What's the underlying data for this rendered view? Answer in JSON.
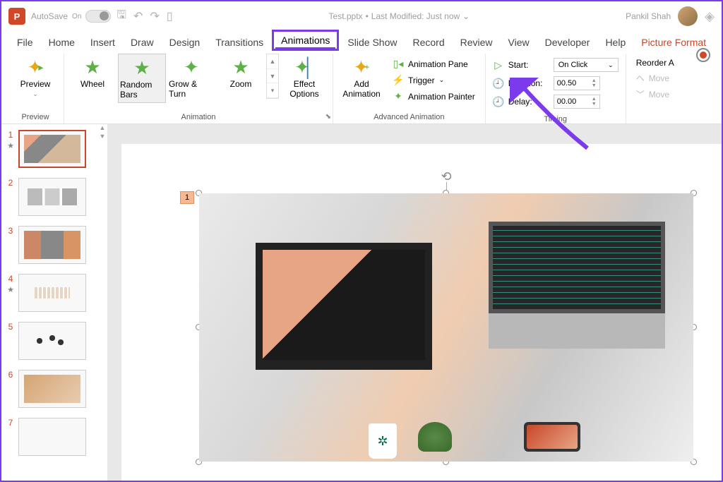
{
  "titlebar": {
    "app_letter": "P",
    "autosave_label": "AutoSave",
    "autosave_state": "On",
    "filename": "Test.pptx",
    "modified": "Last Modified: Just now",
    "username": "Pankil Shah"
  },
  "tabs": [
    "File",
    "Home",
    "Insert",
    "Draw",
    "Design",
    "Transitions",
    "Animations",
    "Slide Show",
    "Record",
    "Review",
    "View",
    "Developer",
    "Help",
    "Picture Format"
  ],
  "active_tab": "Animations",
  "ribbon": {
    "preview": {
      "label": "Preview",
      "group": "Preview"
    },
    "animations": {
      "items": [
        "Wheel",
        "Random Bars",
        "Grow & Turn",
        "Zoom"
      ],
      "selected": "Random Bars",
      "group_label": "Animation"
    },
    "effect_options": "Effect\nOptions",
    "advanced": {
      "add_animation": "Add\nAnimation",
      "animation_pane": "Animation Pane",
      "trigger": "Trigger",
      "animation_painter": "Animation Painter",
      "group_label": "Advanced Animation"
    },
    "timing": {
      "start_label": "Start:",
      "start_value": "On Click",
      "duration_label": "Duration:",
      "duration_value": "00.50",
      "delay_label": "Delay:",
      "delay_value": "00.00",
      "group_label": "Timing"
    },
    "reorder": {
      "title": "Reorder A",
      "move_earlier": "Move",
      "move_later": "Move"
    }
  },
  "slides": [
    {
      "num": "1",
      "has_anim": true
    },
    {
      "num": "2",
      "has_anim": false
    },
    {
      "num": "3",
      "has_anim": false
    },
    {
      "num": "4",
      "has_anim": true
    },
    {
      "num": "5",
      "has_anim": false
    },
    {
      "num": "6",
      "has_anim": false
    },
    {
      "num": "7",
      "has_anim": false
    }
  ],
  "active_slide": 0,
  "animation_tag": "1"
}
